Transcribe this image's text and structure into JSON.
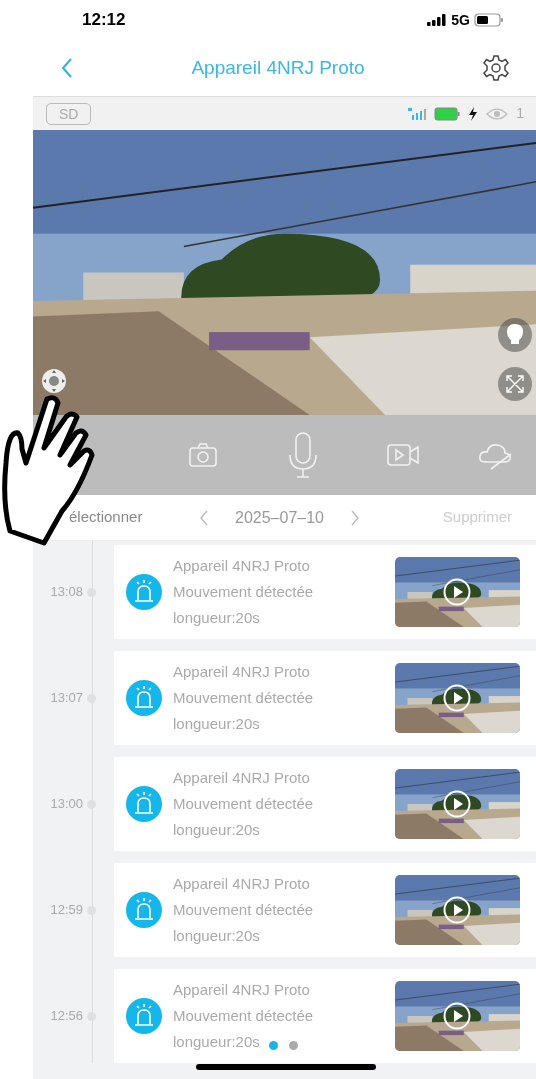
{
  "status_bar": {
    "time": "12:12",
    "network": "5G"
  },
  "header": {
    "title": "Appareil 4NRJ Proto"
  },
  "camera_bar": {
    "storage_badge": "SD",
    "viewers": "1"
  },
  "controls": [
    {
      "kind": "snapshot"
    },
    {
      "kind": "microphone"
    },
    {
      "kind": "record"
    },
    {
      "kind": "cloud"
    }
  ],
  "filter_bar": {
    "select": "électionner",
    "date": "2025–07–10",
    "delete": "Supprimer"
  },
  "events": [
    {
      "time": "13:08",
      "device": "Appareil 4NRJ Proto",
      "event": "Mouvement détectée",
      "length": "longueur:20s"
    },
    {
      "time": "13:07",
      "device": "Appareil 4NRJ Proto",
      "event": "Mouvement détectée",
      "length": "longueur:20s"
    },
    {
      "time": "13:00",
      "device": "Appareil 4NRJ Proto",
      "event": "Mouvement détectée",
      "length": "longueur:20s"
    },
    {
      "time": "12:59",
      "device": "Appareil 4NRJ Proto",
      "event": "Mouvement détectée",
      "length": "longueur:20s"
    },
    {
      "time": "12:56",
      "device": "Appareil 4NRJ Proto",
      "event": "Mouvement détectée",
      "length": "longueur:20s"
    }
  ],
  "pager": [
    {
      "selected": true
    },
    {
      "selected": false
    }
  ]
}
